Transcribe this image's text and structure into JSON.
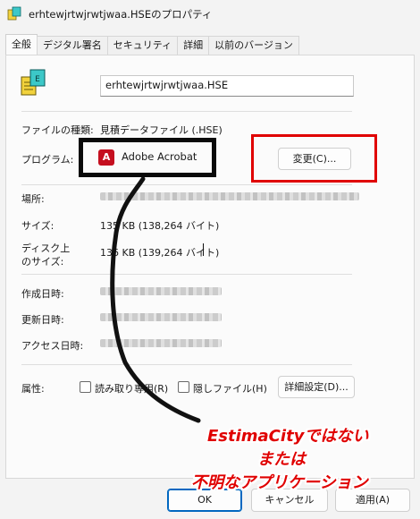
{
  "window": {
    "title": "erhtewjrtwjrwtjwaa.HSEのプロパティ"
  },
  "tabs": [
    {
      "label": "全般"
    },
    {
      "label": "デジタル署名"
    },
    {
      "label": "セキュリティ"
    },
    {
      "label": "詳細"
    },
    {
      "label": "以前のバージョン"
    }
  ],
  "general": {
    "filename": "erhtewjrtwjrwtjwaa.HSE",
    "file_type_label": "ファイルの種類:",
    "file_type_value": "見積データファイル (.HSE)",
    "program_label": "プログラム:",
    "program_value": "Adobe Acrobat",
    "change_button": "変更(C)...",
    "location_label": "場所:",
    "size_label": "サイズ:",
    "size_value": "135 KB (138,264 バイト)",
    "disk_size_label_1": "ディスク上",
    "disk_size_label_2": "のサイズ:",
    "disk_size_value": "136 KB (139,264 バイト)",
    "created_label": "作成日時:",
    "modified_label": "更新日時:",
    "accessed_label": "アクセス日時:",
    "attributes_label": "属性:",
    "readonly_label": "読み取り専用(R)",
    "hidden_label": "隠しファイル(H)",
    "advanced_button": "詳細設定(D)..."
  },
  "buttons": {
    "ok": "OK",
    "cancel": "キャンセル",
    "apply": "適用(A)"
  },
  "annotation": {
    "line1": "EstimaCityではない",
    "line2": "または",
    "line3": "不明なアプリケーション",
    "color": "#e00000"
  },
  "colors": {
    "accent": "#0067c0",
    "acrobat_red": "#c50f1f",
    "highlight_red": "#e00000"
  }
}
